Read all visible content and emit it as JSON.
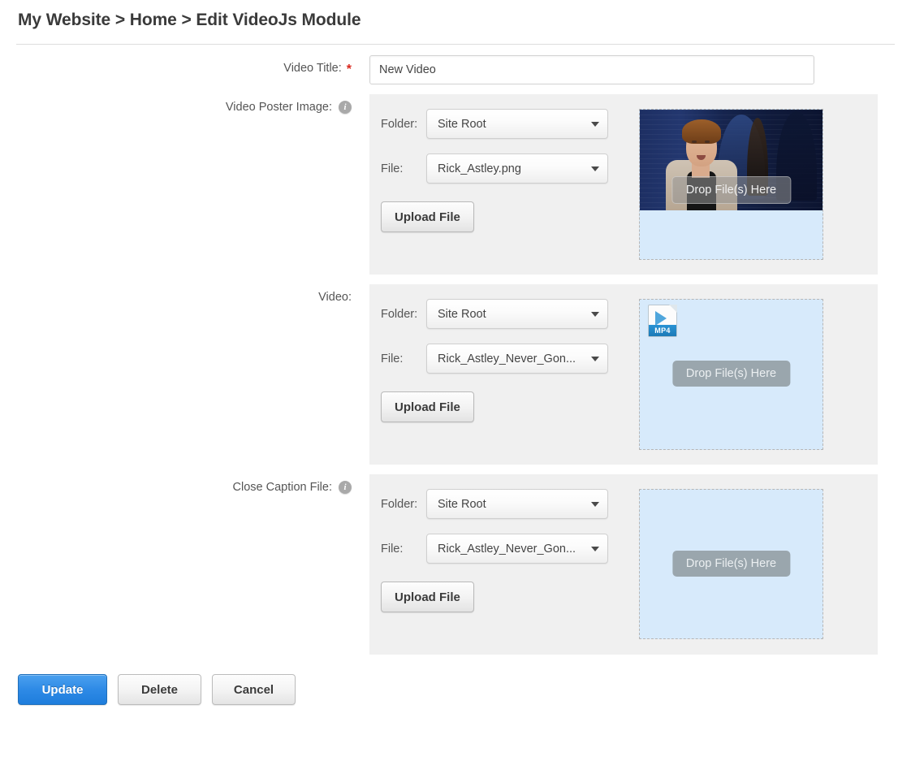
{
  "header": {
    "breadcrumb": "My Website > Home > Edit VideoJs Module"
  },
  "fields": {
    "video_title": {
      "label": "Video Title:",
      "required_marker": "*",
      "value": "New Video",
      "placeholder": ""
    },
    "poster_image": {
      "label": "Video Poster Image:",
      "info_icon": "info-icon",
      "folder_label": "Folder:",
      "folder_value": "Site Root",
      "file_label": "File:",
      "file_value": "Rick_Astley.png",
      "upload_button": "Upload File",
      "dropzone_text": "Drop File(s) Here",
      "has_preview": true
    },
    "video": {
      "label": "Video:",
      "folder_label": "Folder:",
      "folder_value": "Site Root",
      "file_label": "File:",
      "file_value": "Rick_Astley_Never_Gon...",
      "upload_button": "Upload File",
      "dropzone_text": "Drop File(s) Here",
      "file_icon_label": "MP4"
    },
    "close_caption": {
      "label": "Close Caption File:",
      "info_icon": "info-icon",
      "folder_label": "Folder:",
      "folder_value": "Site Root",
      "file_label": "File:",
      "file_value": "Rick_Astley_Never_Gon...",
      "upload_button": "Upload File",
      "dropzone_text": "Drop File(s) Here"
    }
  },
  "footer": {
    "update": "Update",
    "delete": "Delete",
    "cancel": "Cancel"
  },
  "icons": {
    "info": "i",
    "caret": "chevron-down-icon"
  },
  "colors": {
    "primary_button": "#2e8ae6",
    "required_star": "#d9261c",
    "panel_background": "#f0f0f0",
    "dropzone_background": "#d7eafb",
    "dropzone_border": "#b6b6b6",
    "drop_badge": "#9aa6ad"
  }
}
